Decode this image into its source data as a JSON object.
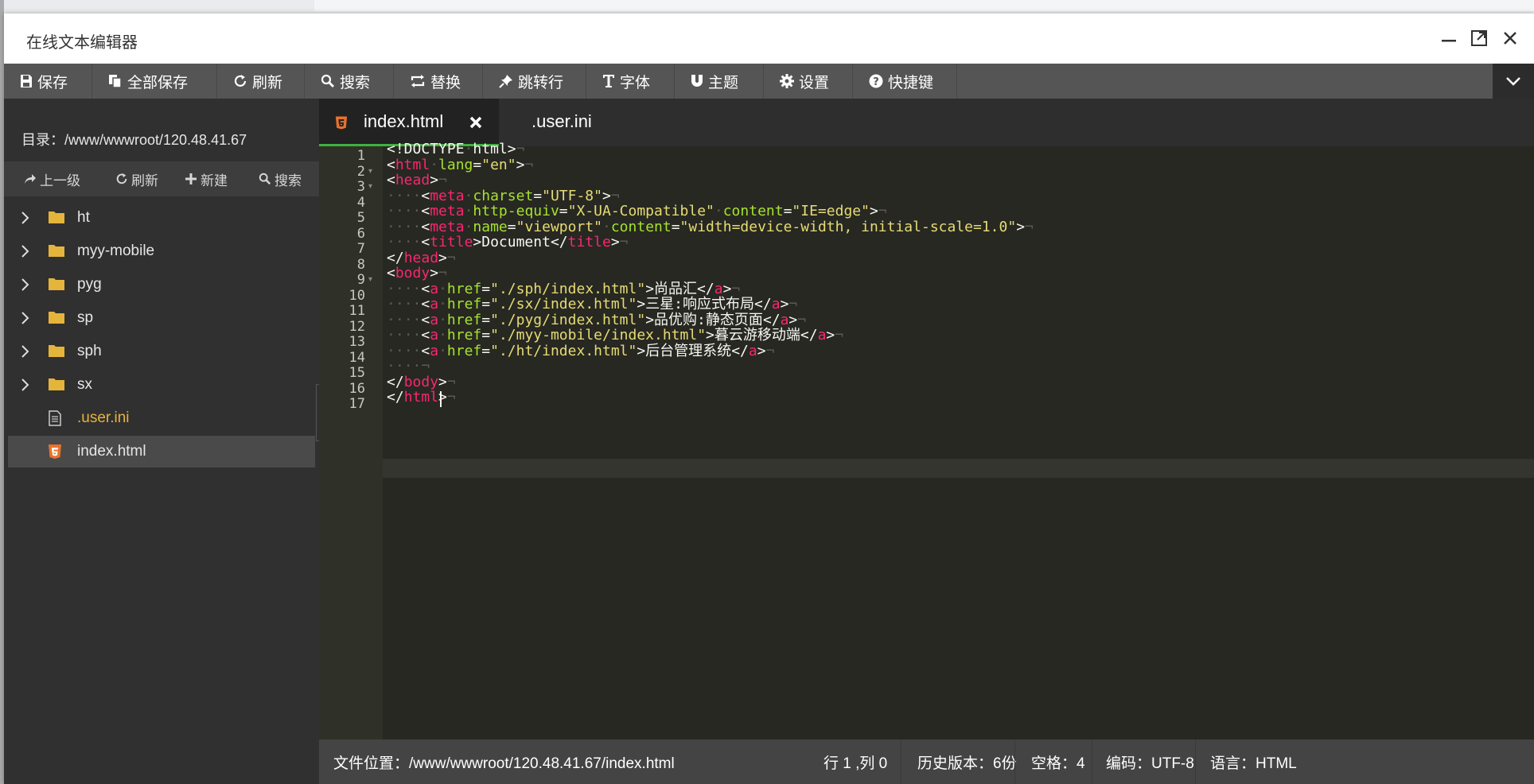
{
  "window": {
    "title": "在线文本编辑器"
  },
  "toolbar": {
    "items": [
      {
        "label": "保存",
        "icon": "save-icon"
      },
      {
        "label": "全部保存",
        "icon": "copy-icon"
      },
      {
        "label": "刷新",
        "icon": "refresh-icon"
      },
      {
        "label": "搜索",
        "icon": "search-icon"
      },
      {
        "label": "替换",
        "icon": "replace-icon"
      },
      {
        "label": "跳转行",
        "icon": "pin-icon"
      },
      {
        "label": "字体",
        "icon": "font-icon"
      },
      {
        "label": "主题",
        "icon": "magnet-icon"
      },
      {
        "label": "设置",
        "icon": "gear-icon"
      },
      {
        "label": "快捷键",
        "icon": "question-icon"
      }
    ]
  },
  "sidebar": {
    "directory": "目录：/www/wwwroot/120.48.41.67",
    "tools": {
      "up": "上一级",
      "refresh": "刷新",
      "new": "新建",
      "search": "搜索"
    },
    "tree": [
      {
        "name": "ht",
        "type": "folder"
      },
      {
        "name": "myy-mobile",
        "type": "folder"
      },
      {
        "name": "pyg",
        "type": "folder"
      },
      {
        "name": "sp",
        "type": "folder"
      },
      {
        "name": "sph",
        "type": "folder"
      },
      {
        "name": "sx",
        "type": "folder"
      },
      {
        "name": ".user.ini",
        "type": "file"
      },
      {
        "name": "index.html",
        "type": "html",
        "selected": true
      }
    ]
  },
  "tabs": [
    {
      "label": "index.html",
      "active": true
    },
    {
      "label": ".user.ini",
      "active": false
    }
  ],
  "editor": {
    "line_numbers": [
      "1",
      "2",
      "3",
      "4",
      "5",
      "6",
      "7",
      "8",
      "9",
      "10",
      "11",
      "12",
      "13",
      "14",
      "15",
      "16",
      "17"
    ],
    "lines": [
      "<!DOCTYPE html>",
      "<html lang=\"en\">",
      "<head>",
      "    <meta charset=\"UTF-8\">",
      "    <meta http-equiv=\"X-UA-Compatible\" content=\"IE=edge\">",
      "    <meta name=\"viewport\" content=\"width=device-width, initial-scale=1.0\">",
      "    <title>Document</title>",
      "</head>",
      "<body>",
      "    <a href=\"./sph/index.html\">尚品汇</a>",
      "    <a href=\"./sx/index.html\">三星:响应式布局</a>",
      "    <a href=\"./pyg/index.html\">品优购:静态页面</a>",
      "    <a href=\"./myy-mobile/index.html\">暮云游移动端</a>",
      "    <a href=\"./ht/index.html\">后台管理系统</a>",
      "    ",
      "</body>",
      "</html>"
    ]
  },
  "statusbar": {
    "path": "文件位置：/www/wwwroot/120.48.41.67/index.html",
    "position": "行 1 ,列 0",
    "history": "历史版本：6份",
    "indent": "空格：4",
    "encoding": "编码：UTF-8",
    "language": "语言：HTML"
  },
  "colors": {
    "toolbar": "#555555",
    "sidebar": "#303030",
    "editor_bg": "#272822",
    "tag": "#f92672",
    "attr": "#a6e22e",
    "string": "#e6db74",
    "folder": "#e5b43b",
    "html_icon": "#e8732c",
    "active_tab_underline": "#3fb13f"
  }
}
